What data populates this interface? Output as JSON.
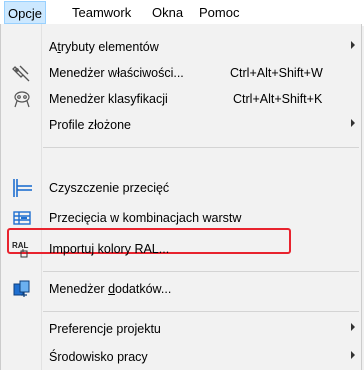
{
  "menubar": {
    "items": [
      {
        "label": "Opcje",
        "active": true
      },
      {
        "label": "Teamwork"
      },
      {
        "label": "Okna"
      },
      {
        "label": "Pomoc"
      }
    ]
  },
  "menu": {
    "items": [
      {
        "label_pre": "A",
        "label_ul": "t",
        "label_post": "rybuty elementów",
        "submenu": true
      },
      {
        "label": "Menedżer właściwości...",
        "shortcut": "Ctrl+Alt+Shift+W",
        "icon": "properties-manager-icon"
      },
      {
        "label": "Menedżer klasyfikacji",
        "shortcut": "Ctrl+Alt+Shift+K",
        "icon": "classification-manager-icon"
      },
      {
        "label": "Profile złożone",
        "submenu": true
      },
      {
        "label": "Czyszczenie przecięć",
        "icon": "intersection-cleanup-icon"
      },
      {
        "label": "Przecięcia w kombinacjach warstw",
        "icon": "layer-intersections-icon",
        "highlighted": true
      },
      {
        "label": "Importuj kolory RAL...",
        "icon": "ral-import-icon",
        "icon_text": "RAL"
      },
      {
        "label_pre": "Menedżer ",
        "label_ul": "d",
        "label_post": "odatków...",
        "icon": "addon-manager-icon"
      },
      {
        "label": "Preferencje projektu",
        "submenu": true
      },
      {
        "label": "Środowisko pracy",
        "submenu": true
      }
    ]
  },
  "colors": {
    "highlight_border": "#e8232e",
    "active_menu_bg": "#cce8ff",
    "icon_blue": "#1f6fd0"
  }
}
